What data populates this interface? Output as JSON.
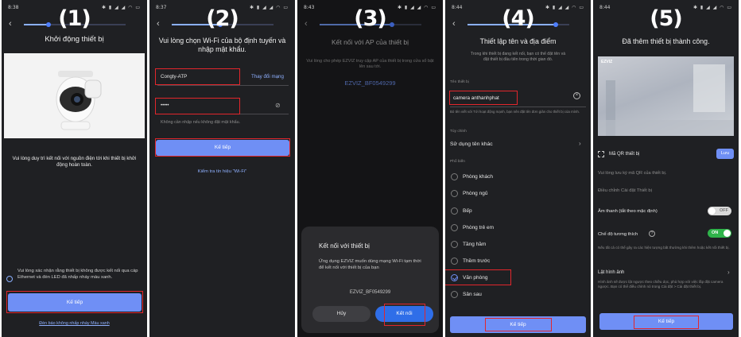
{
  "colors": {
    "accent": "#6f8ff5",
    "highlight": "#e2262c",
    "screen_bg": "#1f2023",
    "toggle_on": "#2fb34a"
  },
  "screens": [
    {
      "step": "(1)",
      "time": "8:38",
      "title": "Khởi động thiết bị",
      "body": "Vui lòng duy trì kết nối với nguồn điện tới khi thiết bị khởi động hoàn toàn.",
      "confirm": "Vui lòng xác nhận rằng thiết bị không được kết nối qua cáp Ethernet và đèn LED đã nhấp nháy màu xanh.",
      "next_label": "Kế tiếp",
      "bottom_link": "Đèn báo không nhấp nháy Màu xanh"
    },
    {
      "step": "(2)",
      "time": "8:37",
      "title": "Vui lòng chọn Wi-Fi của bộ định tuyến và nhập mật khẩu.",
      "ssid": "Congty-ATP",
      "change_network": "Thay đổi mạng",
      "password_mask": "•••••",
      "hint": "Không cần nhập nếu không đặt mật khẩu.",
      "next_label": "Kế tiếp",
      "check_link": "Kiểm tra tín hiệu \"Wi-Fi\""
    },
    {
      "step": "(3)",
      "time": "8:43",
      "title": "Kết nối với AP của thiết bị",
      "body": "Vui lòng cho phép EZVIZ truy cập AP của thiết bị trong cửa sổ bật lên sau tới.",
      "ap_name": "EZVIZ_BF0549299",
      "dialog_title": "Kết nối với thiết bị",
      "dialog_body": "Ứng dụng EZVIZ muốn dùng mạng Wi-Fi tạm thời để kết nối với thiết bị của bạn",
      "dialog_ap": "EZVIZ_BF0549299",
      "cancel_label": "Hủy",
      "connect_label": "Kết nối"
    },
    {
      "step": "(4)",
      "time": "8:44",
      "title": "Thiết lập tên và địa điểm",
      "body": "Trong khi thiết bị đang kết nối, bạn có thể đặt tên và đặt thiết bị đầu tiên trong thời gian đó.",
      "name_label": "Tên thiết bị",
      "name_value": "camera anthanhphat",
      "name_hint": "Bỏ tên viết với Tới hoạt động mạnh, bạn nên đặt tên đơn giản cho thiết bị của mình.",
      "custom_label": "Tùy chỉnh",
      "use_other": "Sử dụng tên khác",
      "suggest_label": "Phổ biến",
      "locations": [
        "Phòng khách",
        "Phòng ngủ",
        "Bếp",
        "Phòng trẻ em",
        "Tầng hầm",
        "Thềm trước",
        "Văn phòng",
        "Sân sau"
      ],
      "selected_location": "Văn phòng",
      "next_label": "Kế tiếp"
    },
    {
      "step": "(5)",
      "time": "8:44",
      "title": "Đã thêm thiết bị thành công.",
      "preview_brand": "EZVIZ",
      "qr_label": "Mã QR thiết bị",
      "save_label": "Lưu",
      "qr_hint": "Vui lòng lưu ký mã QR của thiết bị.",
      "adjust": "Điều chỉnh Cài đặt Thiết bị",
      "sound_label": "Âm thanh (tắt theo mặc định)",
      "sound_state": "OFF",
      "compat_label": "Chế độ tương thích",
      "compat_state": "ON",
      "compat_hint": "Nếu tất cả có thể gây ra các hiện tượng bất thường khi thêm hoặc kết nối thiết bị.",
      "flip_label": "Lật hình ảnh",
      "flip_hint": "Hình ảnh sẽ được lật ngược theo chiều dọc, phù hợp với việc lắp đặt camera ngược. Bạn có thể điều chỉnh nó trong Cài đặt > Cài đặt thiết bị.",
      "next_label": "Kế tiếp"
    }
  ]
}
